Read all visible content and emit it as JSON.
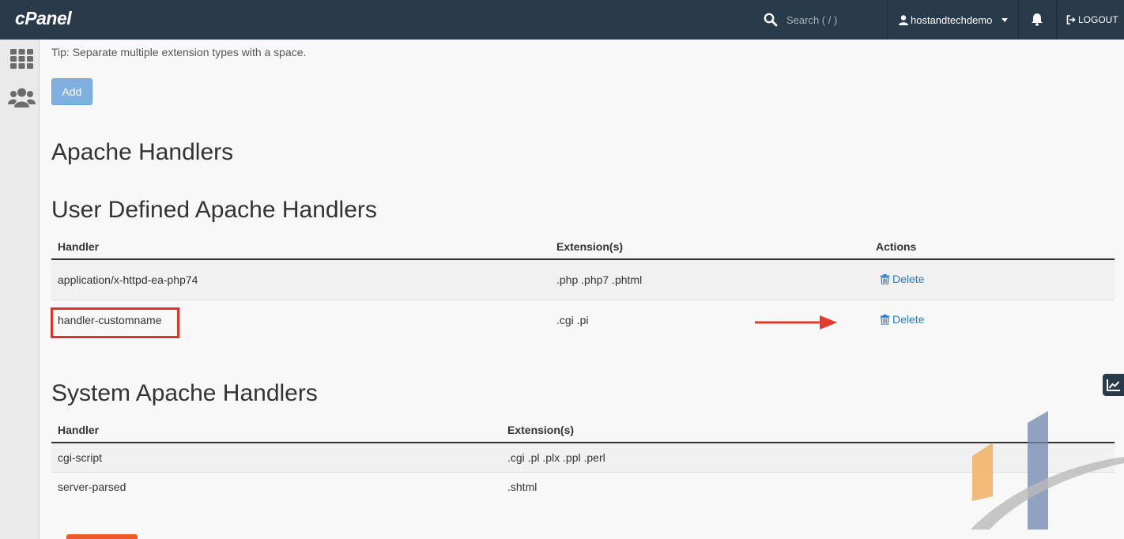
{
  "header": {
    "logo": "cPanel",
    "search_placeholder": "Search ( / )",
    "username": "hostandtechdemo",
    "logout_label": "LOGOUT"
  },
  "sidebar": {
    "items": [
      {
        "icon": "grid-icon"
      },
      {
        "icon": "users-icon"
      }
    ]
  },
  "form": {
    "tip": "Tip: Separate multiple extension types with a space.",
    "add_label": "Add"
  },
  "page_title": "Apache Handlers",
  "user_defined": {
    "title": "User Defined Apache Handlers",
    "columns": [
      "Handler",
      "Extension(s)",
      "Actions"
    ],
    "rows": [
      {
        "handler": "application/x-httpd-ea-php74",
        "extensions": ".php .php7 .phtml",
        "action": "Delete"
      },
      {
        "handler": "handler-customname",
        "extensions": ".cgi .pi",
        "action": "Delete"
      }
    ]
  },
  "system": {
    "title": "System Apache Handlers",
    "columns": [
      "Handler",
      "Extension(s)"
    ],
    "rows": [
      {
        "handler": "cgi-script",
        "extensions": ".cgi .pl .plx .ppl .perl"
      },
      {
        "handler": "server-parsed",
        "extensions": ".shtml"
      }
    ]
  },
  "colors": {
    "nav_bg": "#293a4a",
    "link": "#2a7ac0",
    "annotation": "#d9352b"
  }
}
